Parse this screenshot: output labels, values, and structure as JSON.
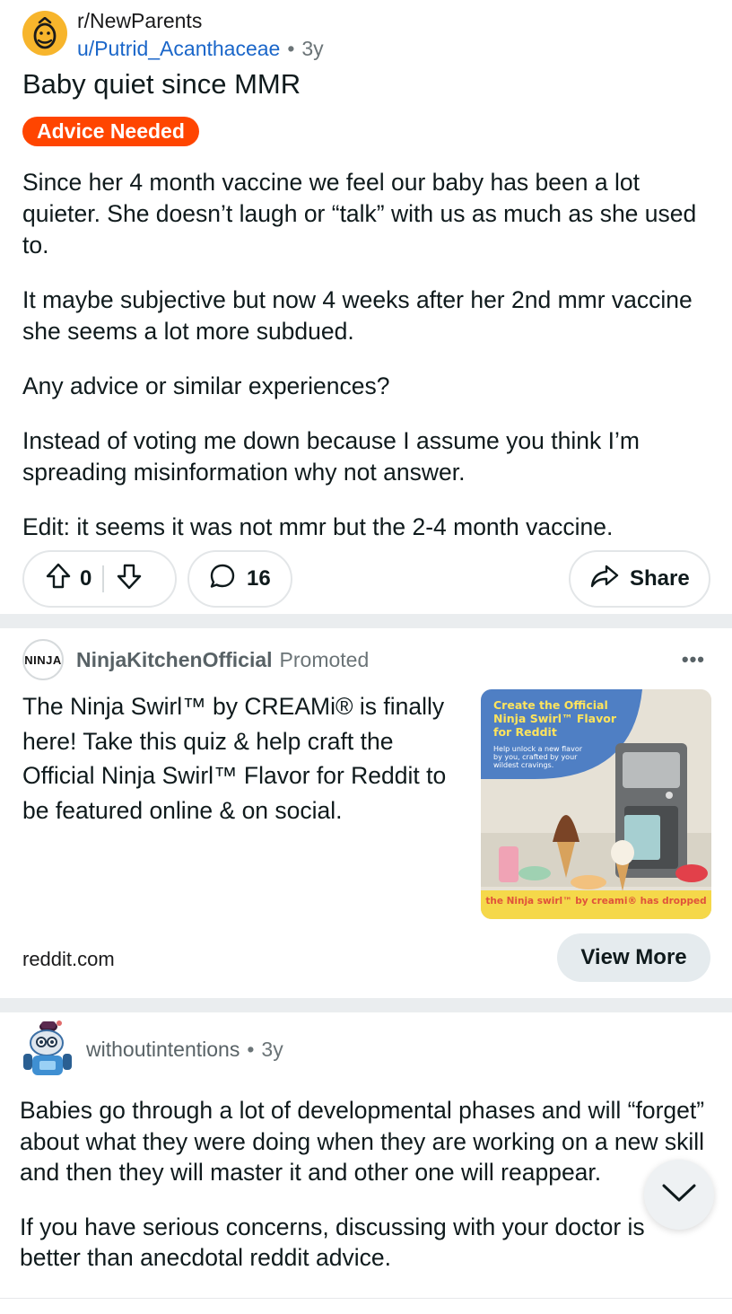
{
  "post": {
    "subreddit": "r/NewParents",
    "author": "u/Putrid_Acanthaceae",
    "separator": "•",
    "age": "3y",
    "title": "Baby quiet since MMR",
    "flair": "Advice Needed",
    "flair_color": "#ff4500",
    "body": [
      "Since her 4 month vaccine we feel our baby has been a lot quieter. She doesn’t laugh or “talk” with us as much as she used to.",
      "It maybe subjective but now 4 weeks after her 2nd mmr vaccine she seems a lot more subdued.",
      "Any advice or similar experiences?",
      "Instead of voting me down because I assume you think I’m spreading misinformation why not answer.",
      "Edit: it seems it was not mmr but the 2-4 month vaccine."
    ],
    "votes": "0",
    "comments": "16",
    "share_label": "Share",
    "icons": {
      "avatar": "subreddit-baby-icon",
      "upvote": "upvote-arrow-icon",
      "downvote": "downvote-arrow-icon",
      "comment": "comment-bubble-icon",
      "share": "share-arrow-icon"
    }
  },
  "ad": {
    "brand": "NinjaKitchenOfficial",
    "promoted": "Promoted",
    "logo_text": "NINJA",
    "more": "•••",
    "text": "The Ninja Swirl™ by CREAMi® is finally here! Take this quiz & help craft the Official Ninja Swirl™ Flavor for Reddit to be featured online & on social.",
    "image": {
      "headline": "Create the Official Ninja Swirl™ Flavor for Reddit",
      "subtext": "Help unlock a new flavor by you, crafted by your wildest cravings.",
      "footer": "the Ninja swirl™ by creami® has dropped",
      "bubble_color": "#4f7fc4",
      "footer_color": "#f5d84a"
    },
    "domain": "reddit.com",
    "cta": "View More"
  },
  "comment": {
    "user": "withoutintentions",
    "separator": "•",
    "age": "3y",
    "body": [
      "Babies go through a lot of developmental phases and will “forget” about what they were doing when they are working on a new skill and then they will master it and other one will reappear.",
      "If you have serious concerns, discussing with your doctor is better than anecdotal reddit advice."
    ],
    "icons": {
      "avatar": "snoo-avatar-icon",
      "scroll": "chevron-down-icon"
    }
  },
  "colors": {
    "link_blue": "#1a66c9",
    "separator_gray": "#eaedef",
    "text": "#0f1a1c"
  }
}
